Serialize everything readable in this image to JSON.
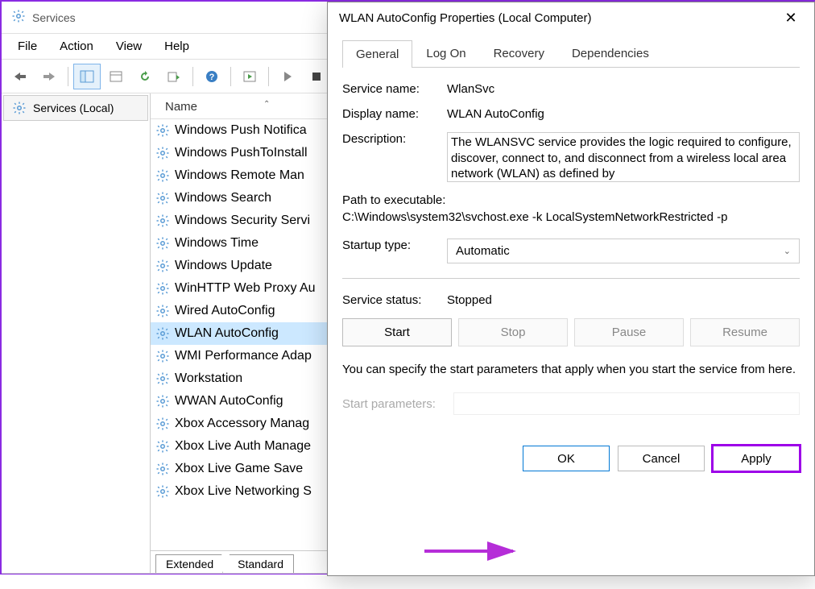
{
  "window": {
    "title": "Services",
    "menus": [
      "File",
      "Action",
      "View",
      "Help"
    ],
    "tree_label": "Services (Local)",
    "column_header": "Name",
    "bottom_tabs": [
      "Extended",
      "Standard"
    ]
  },
  "services": [
    "Windows Push Notifica",
    "Windows PushToInstall",
    "Windows Remote Man",
    "Windows Search",
    "Windows Security Servi",
    "Windows Time",
    "Windows Update",
    "WinHTTP Web Proxy Au",
    "Wired AutoConfig",
    "WLAN AutoConfig",
    "WMI Performance Adap",
    "Workstation",
    "WWAN AutoConfig",
    "Xbox Accessory Manag",
    "Xbox Live Auth Manage",
    "Xbox Live Game Save",
    "Xbox Live Networking S"
  ],
  "selected_index": 9,
  "dialog": {
    "title": "WLAN AutoConfig Properties (Local Computer)",
    "tabs": [
      "General",
      "Log On",
      "Recovery",
      "Dependencies"
    ],
    "active_tab": 0,
    "labels": {
      "service_name": "Service name:",
      "display_name": "Display name:",
      "description": "Description:",
      "path": "Path to executable:",
      "startup": "Startup type:",
      "status": "Service status:",
      "params": "Start parameters:"
    },
    "values": {
      "service_name": "WlanSvc",
      "display_name": "WLAN AutoConfig",
      "description": "The WLANSVC service provides the logic required to configure, discover, connect to, and disconnect from a wireless local area network (WLAN) as defined by",
      "path": "C:\\Windows\\system32\\svchost.exe -k LocalSystemNetworkRestricted -p",
      "startup": "Automatic",
      "status": "Stopped"
    },
    "info_text": "You can specify the start parameters that apply when you start the service from here.",
    "svc_buttons": {
      "start": "Start",
      "stop": "Stop",
      "pause": "Pause",
      "resume": "Resume"
    },
    "buttons": {
      "ok": "OK",
      "cancel": "Cancel",
      "apply": "Apply"
    }
  }
}
